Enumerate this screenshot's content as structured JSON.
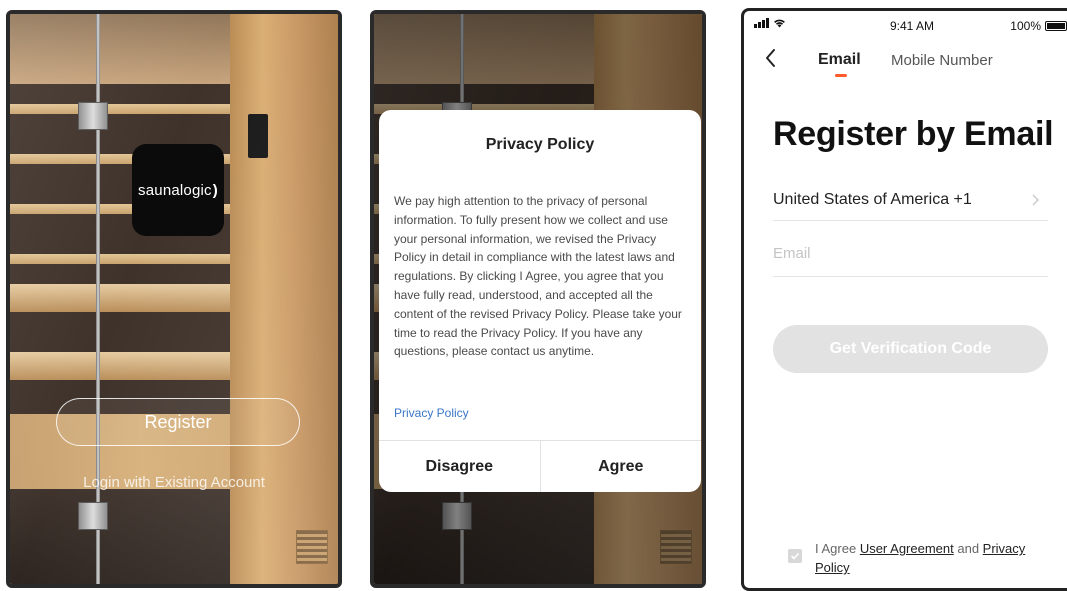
{
  "colors": {
    "accent": "#ff5a2a",
    "link": "#3a76c9",
    "disabled_button": "#e2e2e2"
  },
  "screen1": {
    "logo_text": "saunalogic",
    "logo_mark": ")",
    "register_label": "Register",
    "login_label": "Login with Existing Account"
  },
  "screen2": {
    "dialog": {
      "title": "Privacy Policy",
      "body": "We pay high attention to the privacy of personal information. To fully present how we collect and use your personal information, we revised the Privacy Policy in detail in compliance with the latest laws and regulations. By clicking I Agree, you agree that you have fully read, understood, and accepted all the content of the revised Privacy Policy. Please take your time to read the Privacy Policy. If you have any questions, please contact us anytime.",
      "link": "Privacy Policy",
      "disagree": "Disagree",
      "agree": "Agree"
    }
  },
  "screen3": {
    "status_bar": {
      "time": "9:41 AM",
      "battery": "100%"
    },
    "tabs": [
      {
        "label": "Email",
        "active": true
      },
      {
        "label": "Mobile Number",
        "active": false
      }
    ],
    "title": "Register by Email",
    "country": "United States of America +1",
    "email_placeholder": "Email",
    "verify_button": "Get Verification Code",
    "agreement": {
      "prefix": "I Agree ",
      "user_agreement": "User Agreement",
      "and": " and ",
      "privacy_policy": "Privacy Policy"
    }
  }
}
